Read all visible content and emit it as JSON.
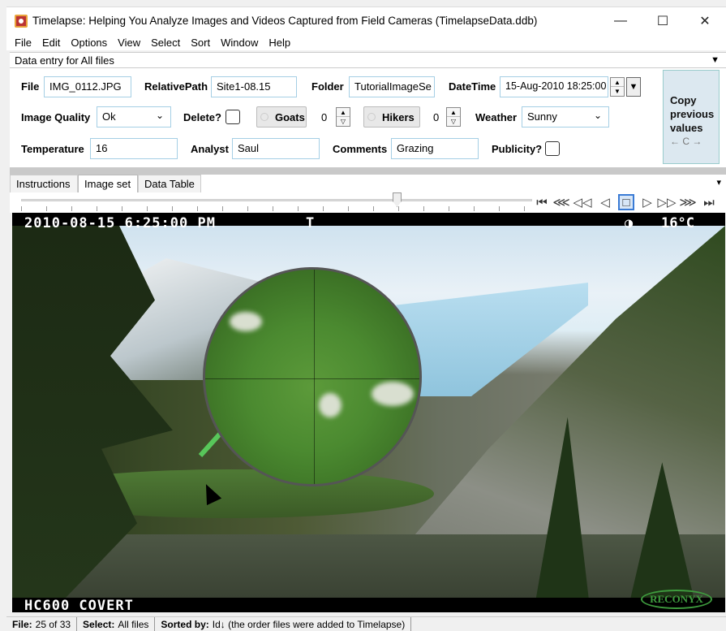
{
  "window": {
    "title": "Timelapse: Helping You Analyze Images and Videos Captured from Field Cameras (TimelapseData.ddb)",
    "minimize": "—",
    "maximize": "☐",
    "close": "✕"
  },
  "menu": [
    "File",
    "Edit",
    "Options",
    "View",
    "Select",
    "Sort",
    "Window",
    "Help"
  ],
  "data_entry": {
    "header": "Data entry for All files",
    "collapse_icon": "▼",
    "file_label": "File",
    "file_value": "IMG_0112.JPG",
    "relpath_label": "RelativePath",
    "relpath_value": "Site1-08.15",
    "folder_label": "Folder",
    "folder_value": "TutorialImageSe",
    "datetime_label": "DateTime",
    "datetime_value": "15-Aug-2010 18:25:00",
    "quality_label": "Image Quality",
    "quality_value": "Ok",
    "delete_label": "Delete?",
    "goats_label": "Goats",
    "goats_value": "0",
    "hikers_label": "Hikers",
    "hikers_value": "0",
    "weather_label": "Weather",
    "weather_value": "Sunny",
    "temperature_label": "Temperature",
    "temperature_value": "16",
    "analyst_label": "Analyst",
    "analyst_value": "Saul",
    "comments_label": "Comments",
    "comments_value": "Grazing",
    "publicity_label": "Publicity?",
    "copy_line1": "Copy",
    "copy_line2": "previous",
    "copy_line3": "values",
    "copy_sub": "← C →"
  },
  "tabs": [
    "Instructions",
    "Image set",
    "Data Table"
  ],
  "tab_menu_icon": "▾",
  "image": {
    "overlay_datetime": "2010-08-15 6:25:00 PM",
    "overlay_t": "T",
    "overlay_moon": "◑",
    "overlay_temp": "16°C",
    "overlay_camera": "HC600 COVERT",
    "brand": "RECONYX"
  },
  "status": {
    "file_label": "File:",
    "file_value": "25 of 33",
    "select_label": "Select:",
    "select_value": "All files",
    "sorted_label": "Sorted by:",
    "sorted_value": "Id↓ (the order files were added to Timelapse)"
  }
}
